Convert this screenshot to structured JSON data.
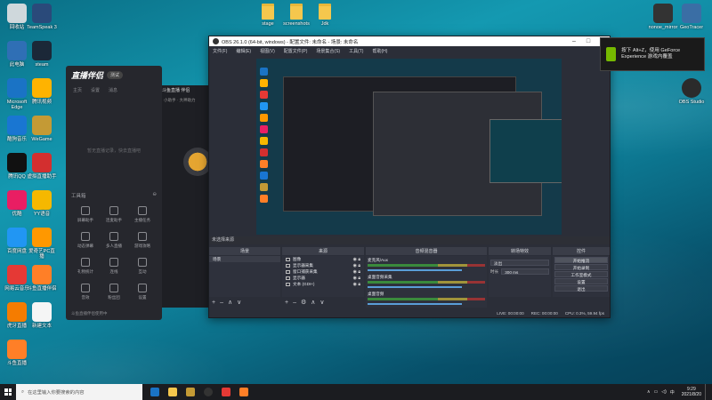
{
  "desktop": {
    "left_icons": [
      {
        "label": "回收站",
        "color": "#cfd8dc"
      },
      {
        "label": "TeamSpeak 3",
        "color": "#2a4a7a"
      },
      {
        "label": "此电脑",
        "color": "#2f6fb5"
      },
      {
        "label": "steam",
        "color": "#1b2838"
      },
      {
        "label": "Microsoft Edge",
        "color": "#1a73c5"
      },
      {
        "label": "腾讯视频",
        "color": "#ffb300"
      },
      {
        "label": "酷狗音乐",
        "color": "#1976d2"
      },
      {
        "label": "WeGame",
        "color": "#c49a35"
      },
      {
        "label": "腾讯QQ",
        "color": "#111111"
      },
      {
        "label": "虚拟直播助手",
        "color": "#d32f2f"
      },
      {
        "label": "优酷",
        "color": "#e91e63"
      },
      {
        "label": "YY语音",
        "color": "#f5b800"
      },
      {
        "label": "百度网盘",
        "color": "#2196f3"
      },
      {
        "label": "爱奇艺PC直播",
        "color": "#ff9800"
      },
      {
        "label": "网易云音乐",
        "color": "#e53935"
      },
      {
        "label": "斗鱼直播伴侣",
        "color": "#ff7f27"
      },
      {
        "label": "虎牙直播",
        "color": "#f57c00"
      },
      {
        "label": "新建文本",
        "color": "#f5f5f5"
      },
      {
        "label": "斗鱼直播",
        "color": "#ff7f27"
      }
    ],
    "top_folders": [
      {
        "label": "stage"
      },
      {
        "label": "screenshots"
      },
      {
        "label": "Jdk"
      }
    ],
    "right_icons": [
      {
        "label": "nonoe_mirror",
        "color": "#333333"
      },
      {
        "label": "GeoTracer",
        "color": "#3a6ea5"
      },
      {
        "label": "OBS Studio",
        "color": "#2b2b2b"
      }
    ]
  },
  "yy_app": {
    "logo": "直播伴侣",
    "badge": "测试",
    "tabs": [
      "主页",
      "设置",
      "消息"
    ],
    "empty_text": "暂无直播记录，快去直播吧",
    "toolbox_title": "工具箱",
    "tools": [
      "屏幕助手",
      "连麦助手",
      "主播任务",
      "动态弹幕",
      "多人直播",
      "游戏攻略",
      "礼物统计",
      "连线",
      "互动",
      "音效",
      "粉丝团",
      "设置"
    ],
    "footer": "斗鱼直播伴侣使用中",
    "stream_title": "斗鱼直播 伴侣",
    "stream_subtitle": "小助手 · 大神助力"
  },
  "obs": {
    "title": "OBS 26.1.0 (64-bit, windows) - 配置文件: 未命名 - 场景: 未命名",
    "menu": [
      "文件(F)",
      "编辑(E)",
      "视图(V)",
      "配置文件(P)",
      "场景集合(S)",
      "工具(T)",
      "帮助(H)"
    ],
    "docks": {
      "scenes_title": "场景",
      "scenes": [
        "场景"
      ],
      "sources_title": "来源",
      "sources": [
        "图像",
        "显示器采集",
        "窗口捕获采集",
        "显示器",
        "文本 (GDI+)"
      ],
      "mixer_title": "音频混音器",
      "mixer_tracks": [
        {
          "name": "麦克风/Aux"
        },
        {
          "name": "桌面音频采集"
        },
        {
          "name": "桌面音频"
        }
      ],
      "transitions_title": "转场特效",
      "transition_type": "淡出",
      "duration_label": "时长",
      "duration_value": "300 ms",
      "controls_title": "控件",
      "controls": [
        "开始推流",
        "开始录制",
        "工作室模式",
        "设置",
        "退出"
      ]
    },
    "status": {
      "live": "LIVE: 00:00:00",
      "rec": "REC: 00:00:00",
      "cpu": "CPU: 0.3%, 59.94 fps"
    },
    "label_unsaved": "未选择来源"
  },
  "toast": {
    "text": "按下 Alt+Z，使用 GeForce Experience 游戏内覆盖"
  },
  "taskbar": {
    "search_placeholder": "在这里输入你要搜索的内容",
    "time": "9:29",
    "date": "2021/8/20",
    "apps": [
      {
        "name": "edge",
        "color": "#1a73c5"
      },
      {
        "name": "explorer",
        "color": "#f5c74d"
      },
      {
        "name": "netease",
        "color": "#c49a35"
      },
      {
        "name": "obs",
        "color": "#333333"
      },
      {
        "name": "cloudmusic",
        "color": "#e53935"
      },
      {
        "name": "douyu",
        "color": "#ff7f27"
      }
    ]
  }
}
